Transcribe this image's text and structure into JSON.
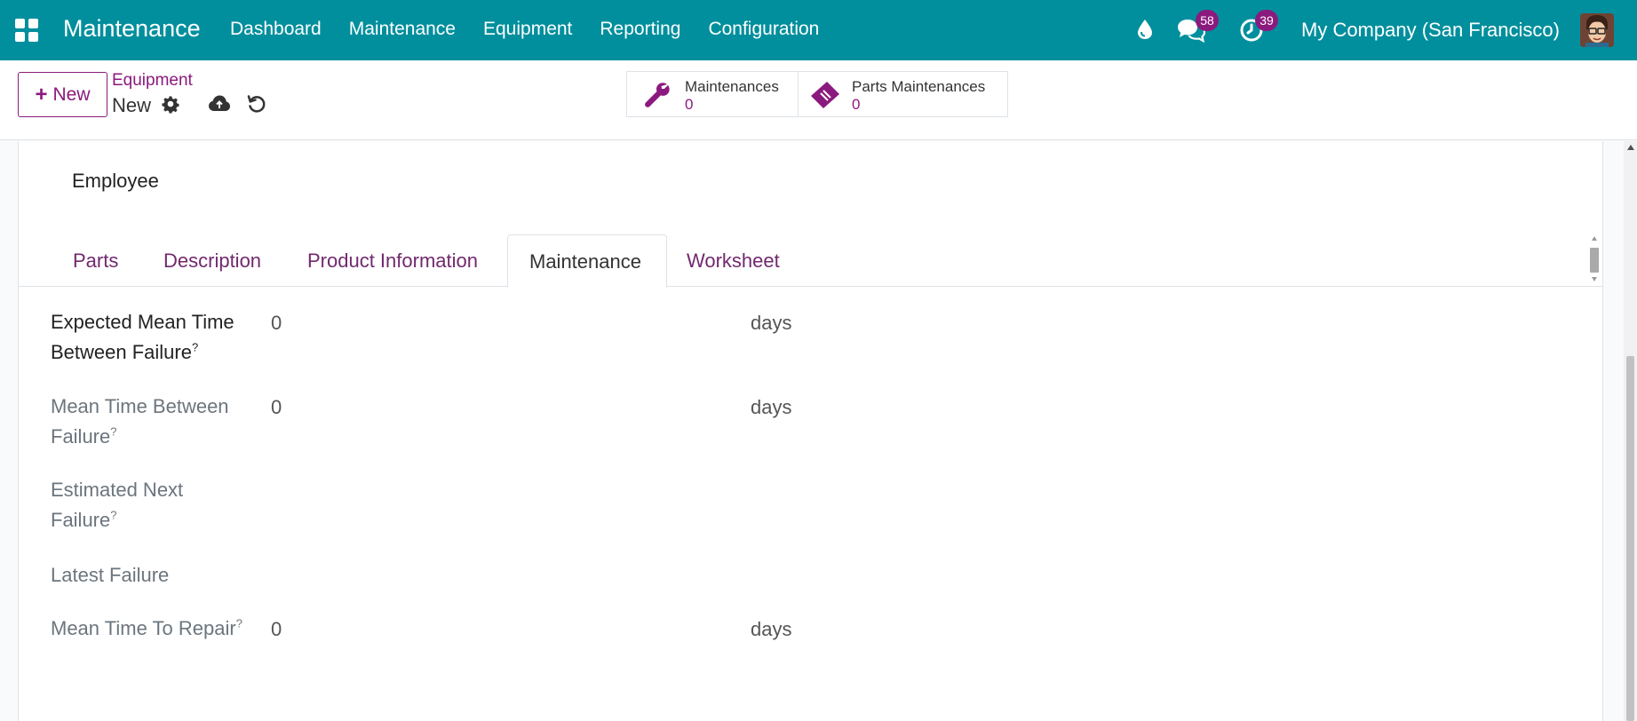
{
  "navbar": {
    "brand": "Maintenance",
    "menu": [
      "Dashboard",
      "Maintenance",
      "Equipment",
      "Reporting",
      "Configuration"
    ],
    "messages_count": "58",
    "activities_count": "39",
    "company": "My Company (San Francisco)"
  },
  "control": {
    "new_label": "New",
    "breadcrumb_parent": "Equipment",
    "breadcrumb_current": "New",
    "stats": [
      {
        "label": "Maintenances",
        "value": "0"
      },
      {
        "label": "Parts Maintenances",
        "value": "0"
      }
    ]
  },
  "form": {
    "employee_label": "Employee",
    "tabs": [
      "Parts",
      "Description",
      "Product Information",
      "Maintenance",
      "Worksheet"
    ],
    "active_tab": "Maintenance",
    "fields": [
      {
        "label_line1": "Expected Mean Time",
        "label_line2": "Between Failure",
        "help": "?",
        "value": "0",
        "unit": "days"
      },
      {
        "label_line1": "Mean Time Between",
        "label_line2": "Failure",
        "help": "?",
        "value": "0",
        "unit": "days"
      },
      {
        "label_line1": "Estimated Next",
        "label_line2": "Failure",
        "help": "?",
        "value": "",
        "unit": ""
      },
      {
        "label_line1": "Latest Failure",
        "label_line2": "",
        "help": "",
        "value": "",
        "unit": ""
      },
      {
        "label_line1": "Mean Time To Repair",
        "label_line2": "",
        "help": "?",
        "value": "0",
        "unit": "days"
      }
    ]
  },
  "colors": {
    "navbar": "#018f9d",
    "accent": "#8b1a7e",
    "tab_link": "#71296e"
  }
}
